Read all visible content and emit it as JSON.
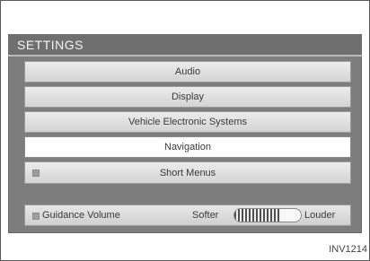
{
  "title": "SETTINGS",
  "menu": {
    "audio": "Audio",
    "display": "Display",
    "vehicle": "Vehicle Electronic Systems",
    "navigation": "Navigation",
    "short_menus": "Short Menus"
  },
  "guidance_volume": {
    "label": "Guidance Volume",
    "softer": "Softer",
    "louder": "Louder",
    "level_fraction": 0.7
  },
  "reference": "INV1214",
  "colors": {
    "screen_background": "#7d7d7d",
    "button": "#e2e2e2",
    "selected_button": "#ffffff"
  }
}
